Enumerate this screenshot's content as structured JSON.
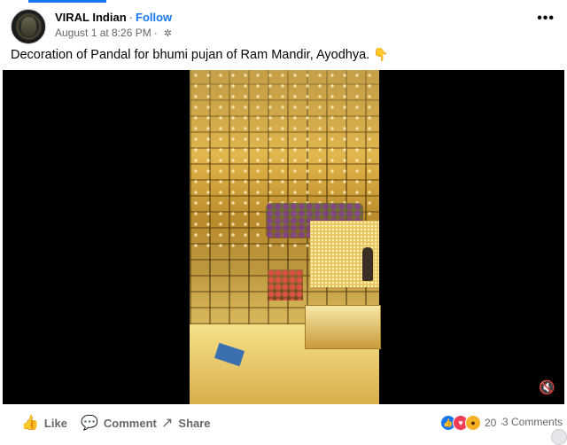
{
  "post": {
    "author": "VIRAL Indian",
    "separator": "·",
    "follow_label": "Follow",
    "timestamp": "August 1 at 8:26 PM",
    "time_separator": "·",
    "privacy_icon": "gear-icon",
    "more_icon": "•••",
    "caption": "Decoration of Pandal for bhumi pujan of Ram Mandir, Ayodhya.",
    "caption_emoji": "👇"
  },
  "video": {
    "mute_icon": "🔇"
  },
  "actions": {
    "like_label": "Like",
    "like_icon": "👍",
    "comment_label": "Comment",
    "comment_icon": "💬",
    "share_label": "Share",
    "share_icon": "↗"
  },
  "reactions": {
    "count": "20",
    "separator": "·",
    "comments": "3 Comments"
  },
  "colors": {
    "accent": "#1877f2",
    "muted_text": "#65676b"
  }
}
